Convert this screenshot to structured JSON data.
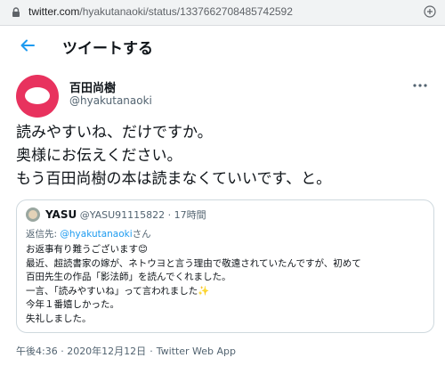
{
  "browser": {
    "url_domain": "twitter.com",
    "url_path": "/hyakutanaoki/status/1337662708485742592"
  },
  "header": {
    "title": "ツイートする"
  },
  "author": {
    "name": "百田尚樹",
    "handle": "@hyakutanaoki"
  },
  "tweet": {
    "lines": [
      "読みやすいね、だけですか。",
      "奥様にお伝えください。",
      "もう百田尚樹の本は読まなくていいです、と。"
    ],
    "timestamp": "午後4:36 · 2020年12月12日",
    "source": "Twitter Web App"
  },
  "quote": {
    "name": "YASU",
    "handle": "@YASU91115822",
    "time": "· 17時間",
    "reply_prefix": "返信先: ",
    "reply_mention": "@hyakutanaoki",
    "reply_suffix": "さん",
    "lines": [
      "お返事有り難うございます😊",
      "最近、超読書家の嫁が、ネトウヨと言う理由で敬遠されていたんですが、初めて",
      "百田先生の作品「影法師」を読んでくれました。",
      "一言、「読みやすいね」って言われました✨",
      "今年１番嬉しかった。",
      "失礼しました。"
    ]
  },
  "colors": {
    "accent": "#1d9bf0",
    "avatar": "#e8325e"
  }
}
